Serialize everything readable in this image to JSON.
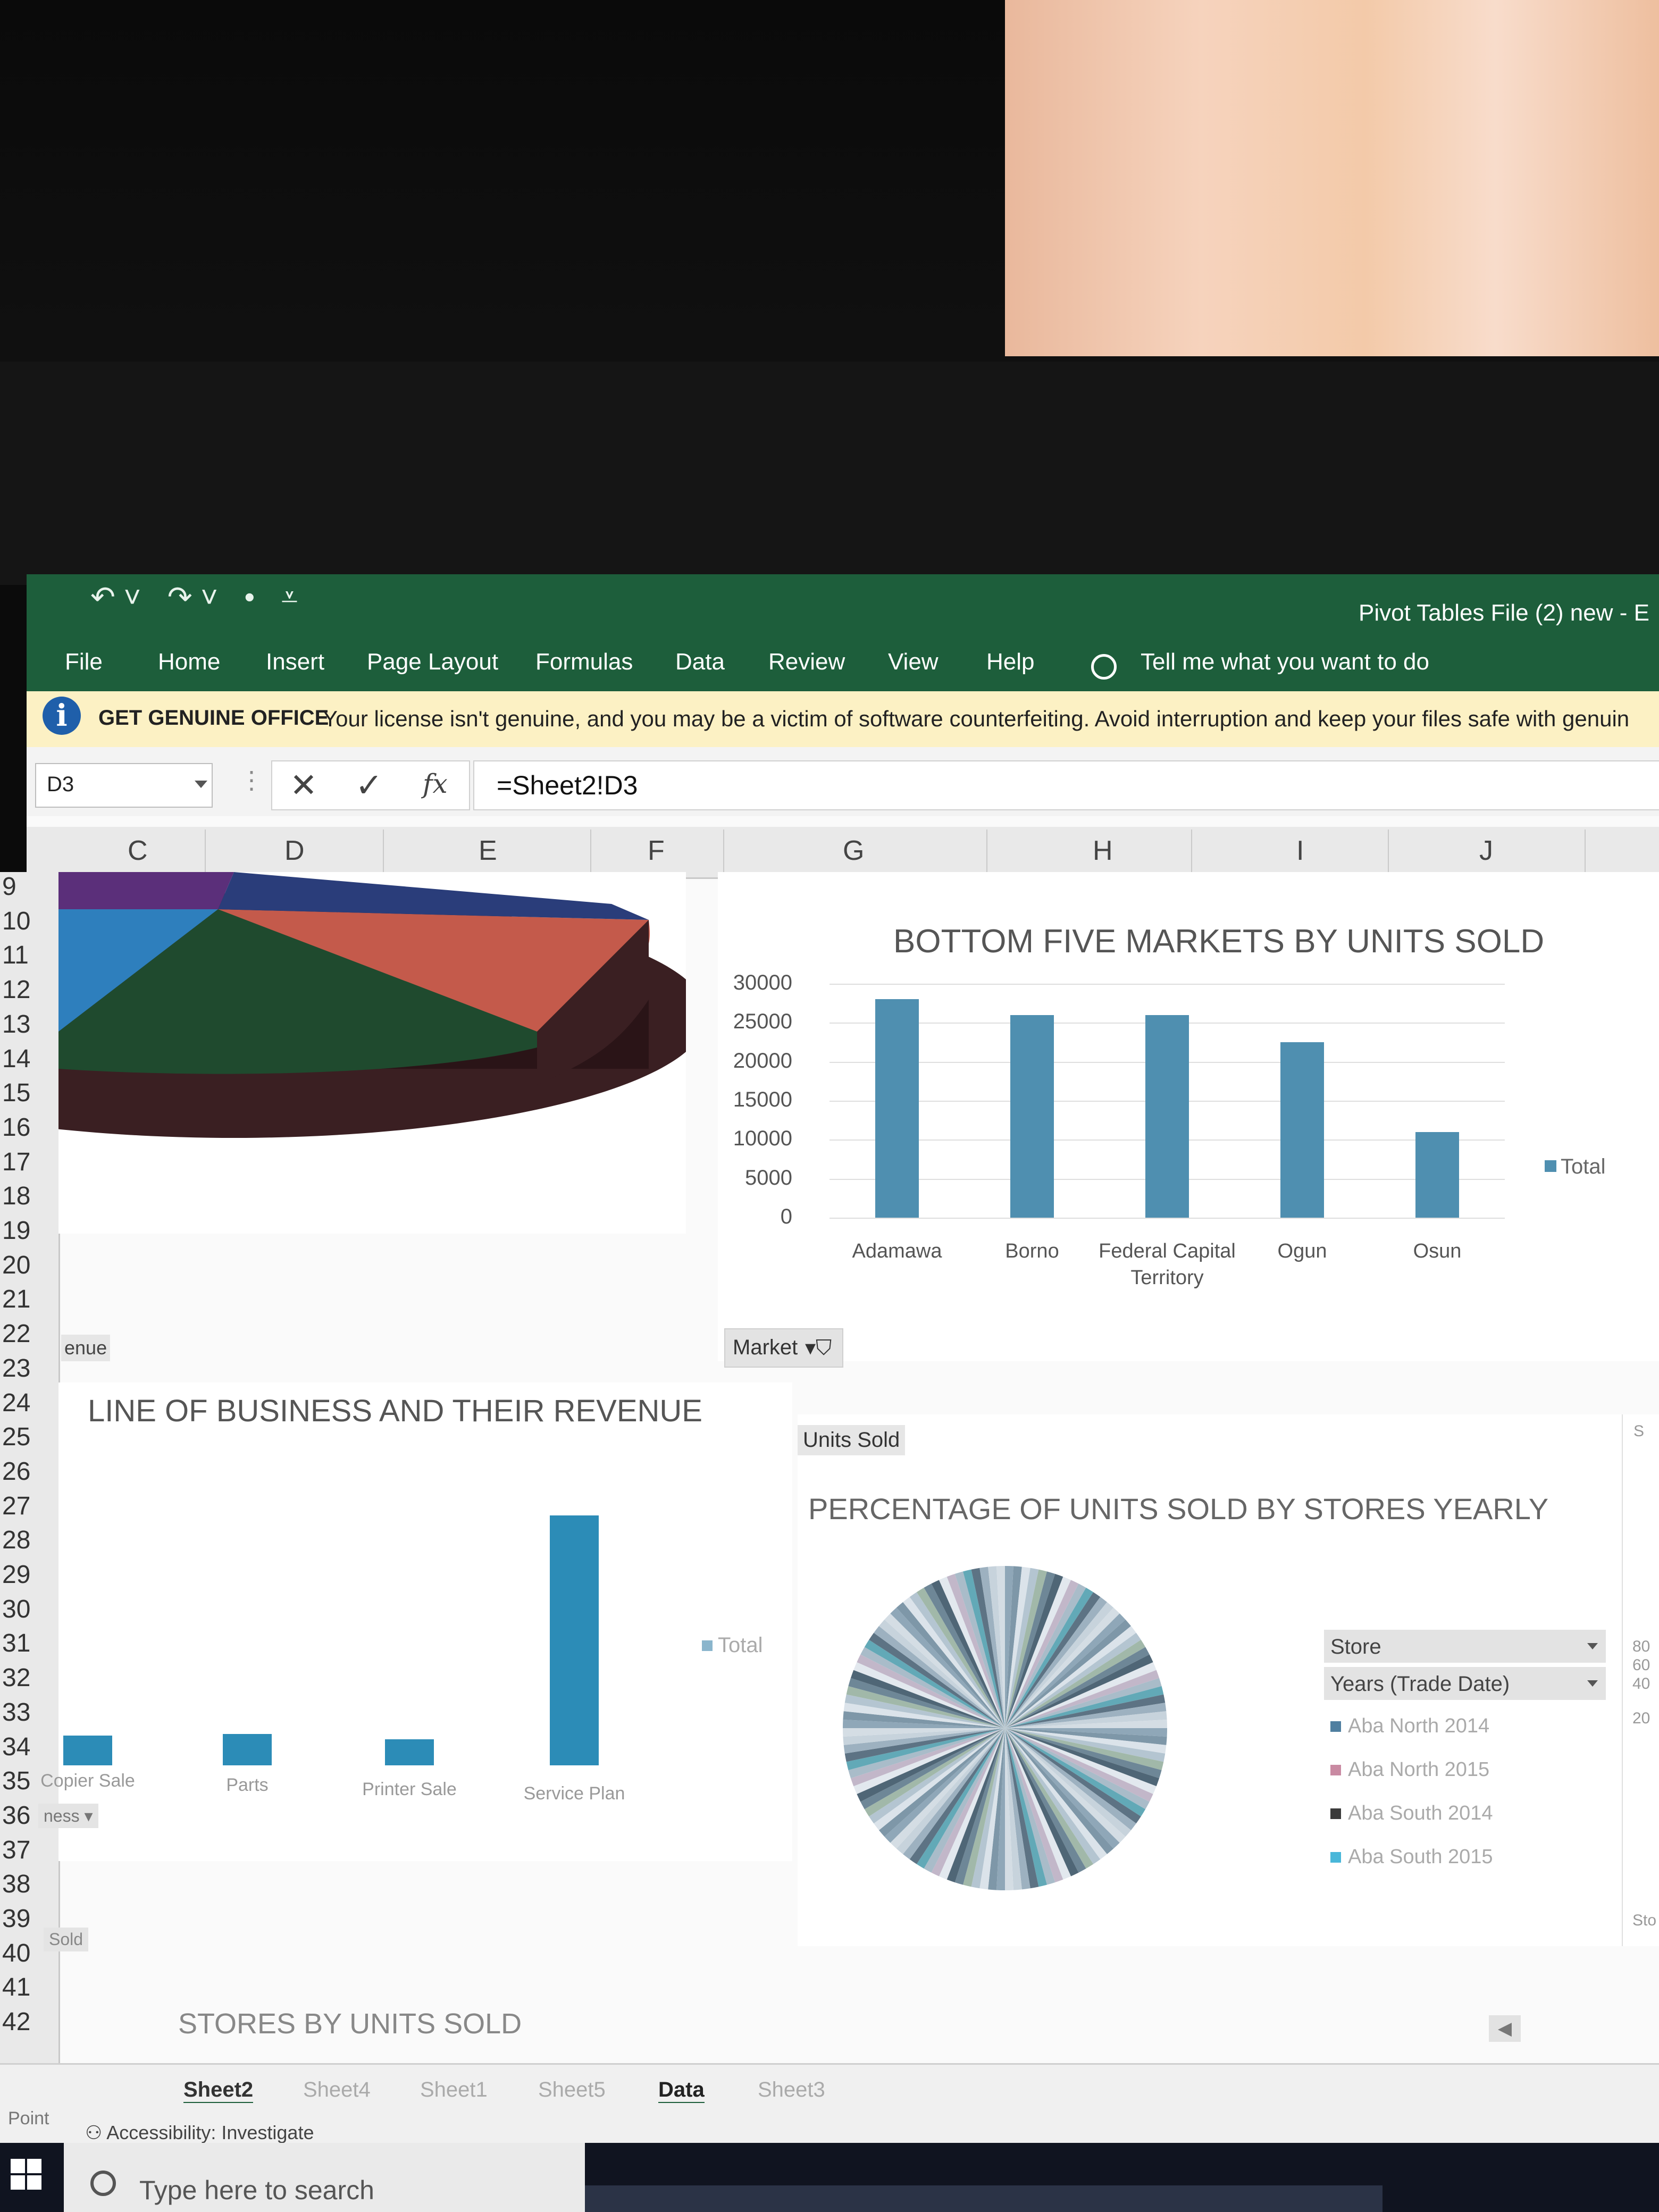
{
  "window": {
    "title": "Pivot Tables File (2) new  -  E",
    "quick_access": {
      "undo": "↶ ˅",
      "redo": "↷ ˅",
      "dot": "•",
      "customize": "⩡"
    }
  },
  "ribbon": {
    "tabs": [
      "File",
      "Home",
      "Insert",
      "Page Layout",
      "Formulas",
      "Data",
      "Review",
      "View",
      "Help"
    ],
    "tell_me": "Tell me what you want to do"
  },
  "message_bar": {
    "title": "GET GENUINE OFFICE",
    "text": "Your license isn't genuine, and you may be a victim of software counterfeiting. Avoid interruption and keep your files safe with genuin"
  },
  "formula_bar": {
    "name_box": "D3",
    "formula": "=Sheet2!D3",
    "cancel": "✕",
    "enter": "✓",
    "fx": "fx",
    "dots": "⋮"
  },
  "columns": [
    "C",
    "D",
    "E",
    "F",
    "G",
    "H",
    "I",
    "J"
  ],
  "rows": [
    "9",
    "10",
    "11",
    "12",
    "13",
    "14",
    "15",
    "16",
    "17",
    "18",
    "19",
    "20",
    "21",
    "22",
    "23",
    "24",
    "25",
    "26",
    "27",
    "28",
    "29",
    "30",
    "31",
    "32",
    "33",
    "34",
    "35",
    "36",
    "37",
    "38",
    "39",
    "40",
    "41",
    "42"
  ],
  "chart_data": [
    {
      "type": "pie",
      "title": "",
      "note": "3D pie, partially visible",
      "slices": [
        {
          "color": "#5b2f7a"
        },
        {
          "color": "#2a3d7a"
        },
        {
          "color": "#2e7fbd"
        },
        {
          "color": "#c45a4b"
        },
        {
          "color": "#1f4a2e"
        },
        {
          "color": "#3a1f22"
        }
      ]
    },
    {
      "type": "bar",
      "title": "BOTTOM FIVE MARKETS BY UNITS SOLD",
      "categories": [
        "Adamawa",
        "Borno",
        "Federal Capital Territory",
        "Ogun",
        "Osun"
      ],
      "series": [
        {
          "name": "Total",
          "values": [
            28000,
            26000,
            26000,
            22500,
            11000
          ]
        }
      ],
      "ylim": [
        0,
        30000
      ],
      "yticks": [
        "30000",
        "25000",
        "20000",
        "15000",
        "10000",
        "5000",
        "0"
      ],
      "grid": true,
      "legend": "right",
      "color": "#4f8fb0",
      "filter_button": "Market"
    },
    {
      "type": "bar",
      "title": "LINE OF BUSINESS AND THEIR REVENUE",
      "categories": [
        "Copier Sale",
        "Parts",
        "Printer Sale",
        "Service Plan"
      ],
      "series": [
        {
          "name": "Total",
          "values": [
            12,
            12.5,
            10.5,
            100
          ]
        }
      ],
      "legend": "right",
      "color": "#2c8cb7"
    },
    {
      "type": "pie",
      "title": "PERCENTAGE OF UNITS SOLD BY STORES YEARLY",
      "legend": "right",
      "filters": [
        "Store",
        "Years (Trade Date)"
      ],
      "legend_entries": [
        {
          "name": "Aba North 2014",
          "color": "#4f7fa0"
        },
        {
          "name": "Aba North 2015",
          "color": "#c98aa2"
        },
        {
          "name": "Aba South 2014",
          "color": "#3b3b3b"
        },
        {
          "name": "Aba South 2015",
          "color": "#49b7d9"
        }
      ]
    }
  ],
  "labels": {
    "enue": "enue",
    "units_sold_tag": "Units Sold",
    "ess_filter": "ness ▾",
    "sold_tag": "Sold",
    "stores_title": "STORES BY UNITS SOLD",
    "right_stub": [
      "80",
      "60",
      "40",
      "20",
      "S",
      "Sto"
    ]
  },
  "sheet_tabs": [
    "Sheet2",
    "Sheet4",
    "Sheet1",
    "Sheet5",
    "Data",
    "Sheet3"
  ],
  "status": {
    "mode": "Point",
    "accessibility": "Accessibility: Investigate"
  },
  "taskbar": {
    "search_placeholder": "Type here to search"
  }
}
